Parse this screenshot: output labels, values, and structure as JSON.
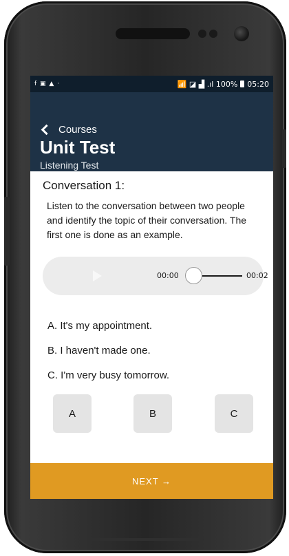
{
  "status_bar": {
    "left_icons": "f ▣ ▲ ·",
    "right_text": "📶 ◪ ▟ .ıl 100%",
    "time": "05:20"
  },
  "header": {
    "back_label": "Courses",
    "title": "Unit Test",
    "subtitle": "Listening Test"
  },
  "conversation": {
    "title": "Conversation 1:",
    "instructions": "Listen to the conversation between two people and identify the topic of their conversation. The first one is done as an example."
  },
  "audio": {
    "current_time": "00:00",
    "total_time": "00:02",
    "progress": 0
  },
  "options": [
    "A. It's my appointment.",
    "B. I haven't made one.",
    "C. I'm very busy tomorrow."
  ],
  "answers": [
    "A",
    "B",
    "C"
  ],
  "next_label": "NEXT →",
  "colors": {
    "header_bg": "#1e3246",
    "status_bg": "#0f1e2c",
    "accent": "#e09a22",
    "answer_bg": "#e4e4e4",
    "player_bg": "#ececec"
  },
  "icons": {
    "back": "chevron-left-icon",
    "play": "play-icon",
    "battery": "battery-icon"
  }
}
